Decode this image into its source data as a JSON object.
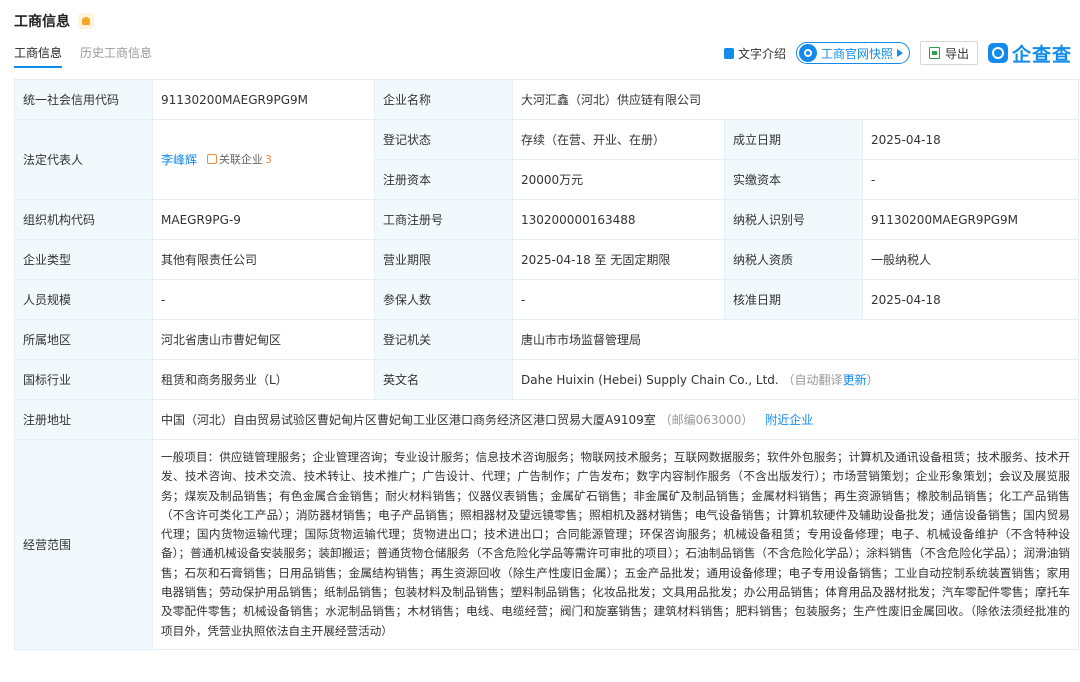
{
  "header": {
    "title": "工商信息"
  },
  "tabs": [
    {
      "label": "工商信息"
    },
    {
      "label": "历史工商信息"
    }
  ],
  "toolbar": {
    "text_intro": "文字介绍",
    "snapshot": "工商官网快照",
    "export": "导出",
    "logo": "企查查"
  },
  "table": {
    "credit_code": {
      "label": "统一社会信用代码",
      "value": "91130200MAEGR9PG9M"
    },
    "company_name": {
      "label": "企业名称",
      "value": "大河汇鑫（河北）供应链有限公司"
    },
    "legal_rep": {
      "label": "法定代表人",
      "name": "李峰辉",
      "related_label": "关联企业",
      "related_count": "3"
    },
    "reg_status": {
      "label": "登记状态",
      "value": "存续（在营、开业、在册）"
    },
    "founded": {
      "label": "成立日期",
      "value": "2025-04-18"
    },
    "reg_capital": {
      "label": "注册资本",
      "value": "20000万元"
    },
    "paid_capital": {
      "label": "实缴资本",
      "value": "-"
    },
    "org_code": {
      "label": "组织机构代码",
      "value": "MAEGR9PG-9"
    },
    "reg_no": {
      "label": "工商注册号",
      "value": "130200000163488"
    },
    "taxpayer_id": {
      "label": "纳税人识别号",
      "value": "91130200MAEGR9PG9M"
    },
    "company_type": {
      "label": "企业类型",
      "value": "其他有限责任公司"
    },
    "term": {
      "label": "营业期限",
      "value": "2025-04-18 至 无固定期限"
    },
    "taxpayer_qual": {
      "label": "纳税人资质",
      "value": "一般纳税人"
    },
    "staff_size": {
      "label": "人员规模",
      "value": "-"
    },
    "insured": {
      "label": "参保人数",
      "value": "-"
    },
    "approval_date": {
      "label": "核准日期",
      "value": "2025-04-18"
    },
    "region": {
      "label": "所属地区",
      "value": "河北省唐山市曹妃甸区"
    },
    "authority": {
      "label": "登记机关",
      "value": "唐山市市场监督管理局"
    },
    "industry": {
      "label": "国标行业",
      "value": "租赁和商务服务业（L）"
    },
    "english_name": {
      "label": "英文名",
      "value": "Dahe Huixin (Hebei) Supply Chain Co., Ltd.",
      "note_prefix": "（自动翻译",
      "note_link": "更新",
      "note_suffix": "）"
    },
    "address": {
      "label": "注册地址",
      "value": "中国（河北）自由贸易试验区曹妃甸片区曹妃甸工业区港口商务经济区港口贸易大厦A9109室",
      "postcode": "（邮编063000）",
      "nearby": "附近企业"
    },
    "scope": {
      "label": "经营范围",
      "value": "一般项目：供应链管理服务；企业管理咨询；专业设计服务；信息技术咨询服务；物联网技术服务；互联网数据服务；软件外包服务；计算机及通讯设备租赁；技术服务、技术开发、技术咨询、技术交流、技术转让、技术推广；广告设计、代理；广告制作；广告发布；数字内容制作服务（不含出版发行）；市场营销策划；企业形象策划；会议及展览服务；煤炭及制品销售；有色金属合金销售；耐火材料销售；仪器仪表销售；金属矿石销售；非金属矿及制品销售；金属材料销售；再生资源销售；橡胶制品销售；化工产品销售（不含许可类化工产品）；消防器材销售；电子产品销售；照相器材及望远镜零售；照相机及器材销售；电气设备销售；计算机软硬件及辅助设备批发；通信设备销售；国内贸易代理；国内货物运输代理；国际货物运输代理；货物进出口；技术进出口；合同能源管理；环保咨询服务；机械设备租赁；专用设备修理；电子、机械设备维护（不含特种设备）；普通机械设备安装服务；装卸搬运；普通货物仓储服务（不含危险化学品等需许可审批的项目）；石油制品销售（不含危险化学品）；涂料销售（不含危险化学品）；润滑油销售；石灰和石膏销售；日用品销售；金属结构销售；再生资源回收（除生产性废旧金属）；五金产品批发；通用设备修理；电子专用设备销售；工业自动控制系统装置销售；家用电器销售；劳动保护用品销售；纸制品销售；包装材料及制品销售；塑料制品销售；化妆品批发；文具用品批发；办公用品销售；体育用品及器材批发；汽车零配件零售；摩托车及零配件零售；机械设备销售；水泥制品销售；木材销售；电线、电缆经营；阀门和旋塞销售；建筑材料销售；肥料销售；包装服务；生产性废旧金属回收。（除依法须经批准的项目外，凭营业执照依法自主开展经营活动）"
    }
  },
  "colors": {
    "accent": "#128bed",
    "label_bg": "#f2f9fc",
    "border": "#e4eef6",
    "bell": "#f5a623",
    "orange": "#f08b3c"
  }
}
